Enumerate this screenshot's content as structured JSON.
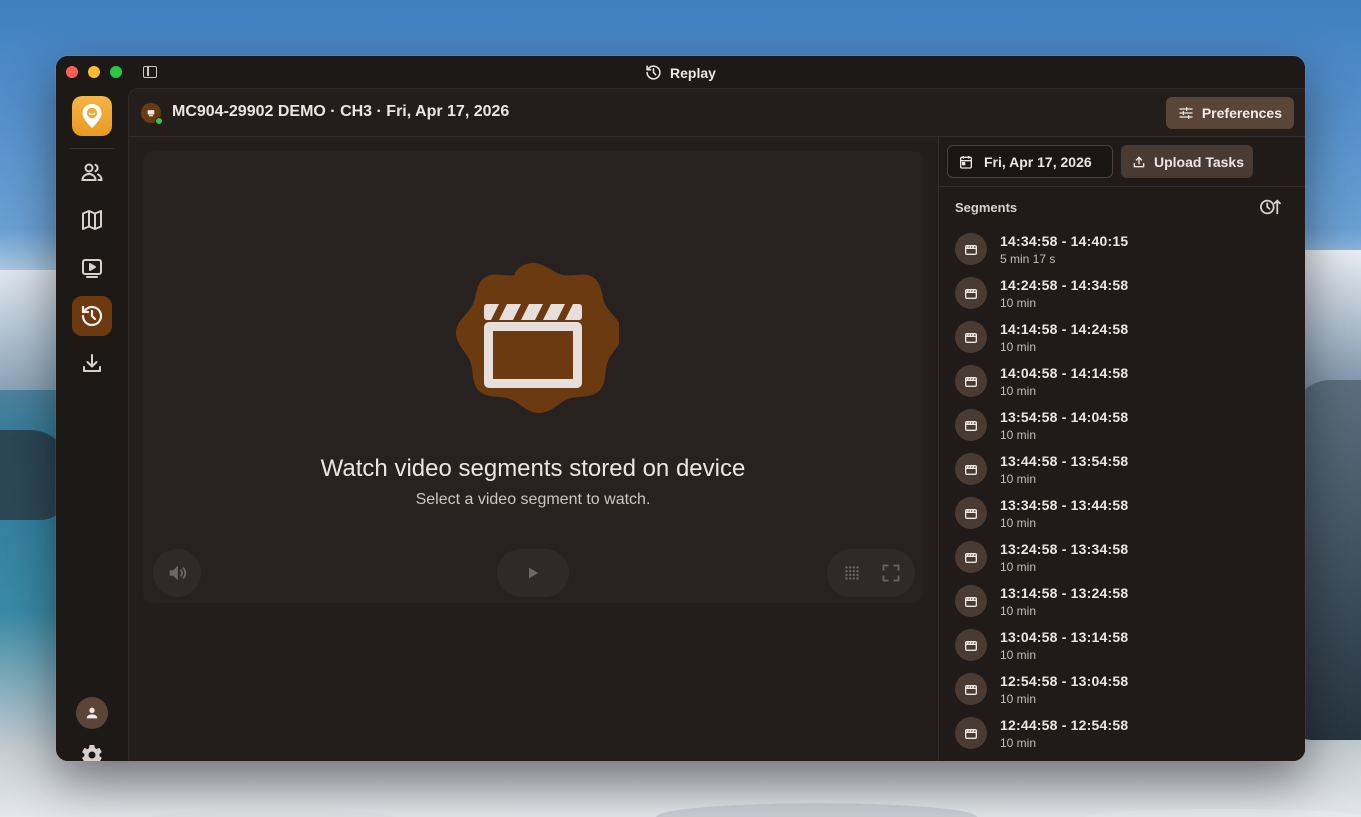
{
  "window": {
    "title": "Replay"
  },
  "header": {
    "title": "MC904-29902 DEMO · CH3 · Fri, Apr 17, 2026",
    "preferences_label": "Preferences"
  },
  "sidebar": {
    "items": [
      {
        "icon": "users-icon",
        "active": false
      },
      {
        "icon": "map-icon",
        "active": false
      },
      {
        "icon": "live-video-icon",
        "active": false
      },
      {
        "icon": "replay-history-icon",
        "active": true
      },
      {
        "icon": "download-icon",
        "active": false
      }
    ]
  },
  "player": {
    "empty_title": "Watch video segments stored on device",
    "empty_subtitle": "Select a video segment to watch."
  },
  "panel": {
    "date_label": "Fri, Apr 17, 2026",
    "upload_label": "Upload Tasks",
    "segments_label": "Segments"
  },
  "segments": [
    {
      "range": "14:34:58 - 14:40:15",
      "duration": "5 min 17 s"
    },
    {
      "range": "14:24:58 - 14:34:58",
      "duration": "10 min"
    },
    {
      "range": "14:14:58 - 14:24:58",
      "duration": "10 min"
    },
    {
      "range": "14:04:58 - 14:14:58",
      "duration": "10 min"
    },
    {
      "range": "13:54:58 - 14:04:58",
      "duration": "10 min"
    },
    {
      "range": "13:44:58 - 13:54:58",
      "duration": "10 min"
    },
    {
      "range": "13:34:58 - 13:44:58",
      "duration": "10 min"
    },
    {
      "range": "13:24:58 - 13:34:58",
      "duration": "10 min"
    },
    {
      "range": "13:14:58 - 13:24:58",
      "duration": "10 min"
    },
    {
      "range": "13:04:58 - 13:14:58",
      "duration": "10 min"
    },
    {
      "range": "12:54:58 - 13:04:58",
      "duration": "10 min"
    },
    {
      "range": "12:44:58 - 12:54:58",
      "duration": "10 min"
    }
  ],
  "colors": {
    "accent": "#6b3a10",
    "logo": "#f0a935",
    "background": "#1d1917"
  }
}
